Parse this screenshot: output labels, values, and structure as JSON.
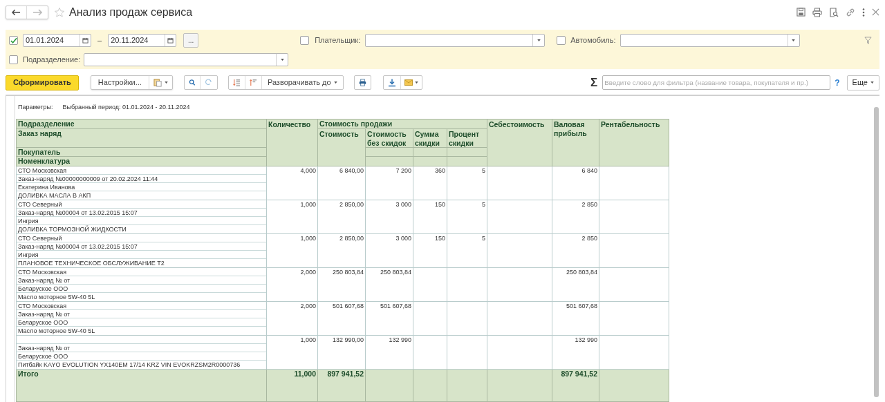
{
  "window": {
    "title": "Анализ продаж сервиса"
  },
  "filters": {
    "period": {
      "checked": true,
      "from": "01.01.2024",
      "dash": "–",
      "to": "20.11.2024",
      "more": "..."
    },
    "payer": {
      "checked": false,
      "label": "Плательщик:"
    },
    "car": {
      "checked": false,
      "label": "Автомобиль:"
    },
    "division": {
      "checked": false,
      "label": "Подразделение:"
    }
  },
  "toolbar": {
    "generate": "Сформировать",
    "settings": "Настройки...",
    "expand": "Разворачивать до",
    "sum_sign": "Σ",
    "search_placeholder": "Введите слово для фильтра (название товара, покупателя и пр.)",
    "help": "?",
    "more": "Еще"
  },
  "report": {
    "parameters_label": "Параметры:",
    "parameters_value": "Выбранный период: 01.01.2024 - 20.11.2024",
    "columns": {
      "grouping": [
        "Подразделение",
        "Заказ наряд",
        "Покупатель",
        "Номенклатура"
      ],
      "quantity": "Количество",
      "sales": {
        "title": "Стоимость продажи",
        "children": [
          "Стоимость",
          "Стоимость без скидок",
          "Сумма скидки",
          "Процент скидки"
        ]
      },
      "cost": "Себестоимость",
      "gross": "Валовая прибыль",
      "profitability": "Рентабельность"
    },
    "rows": [
      {
        "division": "СТО Московская",
        "order": "Заказ-наряд №00000000009 от 20.02.2024 11:44",
        "buyer": "Екатерина Иванова",
        "item": "ДОЛИВКА МАСЛА В АКП",
        "quantity": "4,000",
        "sum": "6 840,00",
        "sum_no_discount": "7 200",
        "discount_sum": "360",
        "discount_pct": "5",
        "gross": "6 840"
      },
      {
        "division": "СТО Северный",
        "order": "Заказ-наряд №00004 от 13.02.2015 15:07",
        "buyer": "Ингрия",
        "item": "ДОЛИВКА ТОРМОЗНОЙ ЖИДКОСТИ",
        "quantity": "1,000",
        "sum": "2 850,00",
        "sum_no_discount": "3 000",
        "discount_sum": "150",
        "discount_pct": "5",
        "gross": "2 850"
      },
      {
        "division": "СТО Северный",
        "order": "Заказ-наряд №00004 от 13.02.2015 15:07",
        "buyer": "Ингрия",
        "item": "ПЛАНОВОЕ ТЕХНИЧЕСКОЕ ОБСЛУЖИВАНИЕ Т2",
        "quantity": "1,000",
        "sum": "2 850,00",
        "sum_no_discount": "3 000",
        "discount_sum": "150",
        "discount_pct": "5",
        "gross": "2 850"
      },
      {
        "division": "СТО Московская",
        "order": "Заказ-наряд № от",
        "buyer": "Беларуское ООО",
        "item": "Масло моторное 5W-40 5L",
        "quantity": "2,000",
        "sum": "250 803,84",
        "sum_no_discount": "250 803,84",
        "gross": "250 803,84"
      },
      {
        "division": "СТО Московская",
        "order": "Заказ-наряд № от",
        "buyer": "Беларуское ООО",
        "item": "Масло моторное 5W-40 5L",
        "quantity": "2,000",
        "sum": "501 607,68",
        "sum_no_discount": "501 607,68",
        "gross": "501 607,68"
      },
      {
        "order": "Заказ-наряд № от",
        "buyer": "Беларуское ООО",
        "item": "Питбайк KAYO EVOLUTION YX140EM 17/14 KRZ VIN EVOKRZSM2R0000736",
        "quantity": "1,000",
        "sum": "132 990,00",
        "sum_no_discount": "132 990",
        "gross": "132 990"
      }
    ],
    "total": {
      "label": "Итого",
      "quantity": "11,000",
      "sum": "897 941,52",
      "gross": "897 941,52"
    }
  }
}
